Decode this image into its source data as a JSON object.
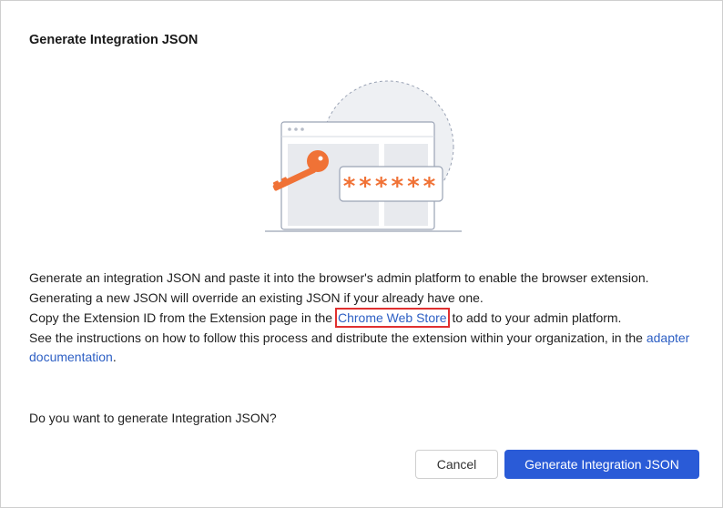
{
  "dialog": {
    "title": "Generate Integration JSON"
  },
  "illustration": {
    "masked_value": "******",
    "accent_color": "#f07236",
    "outline_color": "#9aa3b5"
  },
  "body": {
    "line1": "Generate an integration JSON and paste it into the browser's admin platform to enable the browser extension.",
    "line2": "Generating a new JSON will override an existing JSON if your already have one.",
    "line3_before": "Copy the Extension ID from the Extension page in the ",
    "line3_link": "Chrome Web Store",
    "line3_after": " to add to your admin platform.",
    "line4_before": "See the instructions on how to follow this process and distribute the extension within your organization, in the ",
    "line4_link": "adapter documentation",
    "line4_after": "."
  },
  "question": "Do you want to generate Integration JSON?",
  "buttons": {
    "cancel": "Cancel",
    "confirm": "Generate Integration JSON"
  },
  "colors": {
    "primary": "#2a5bd7",
    "link": "#2d5fc4",
    "highlight": "#e03030"
  }
}
